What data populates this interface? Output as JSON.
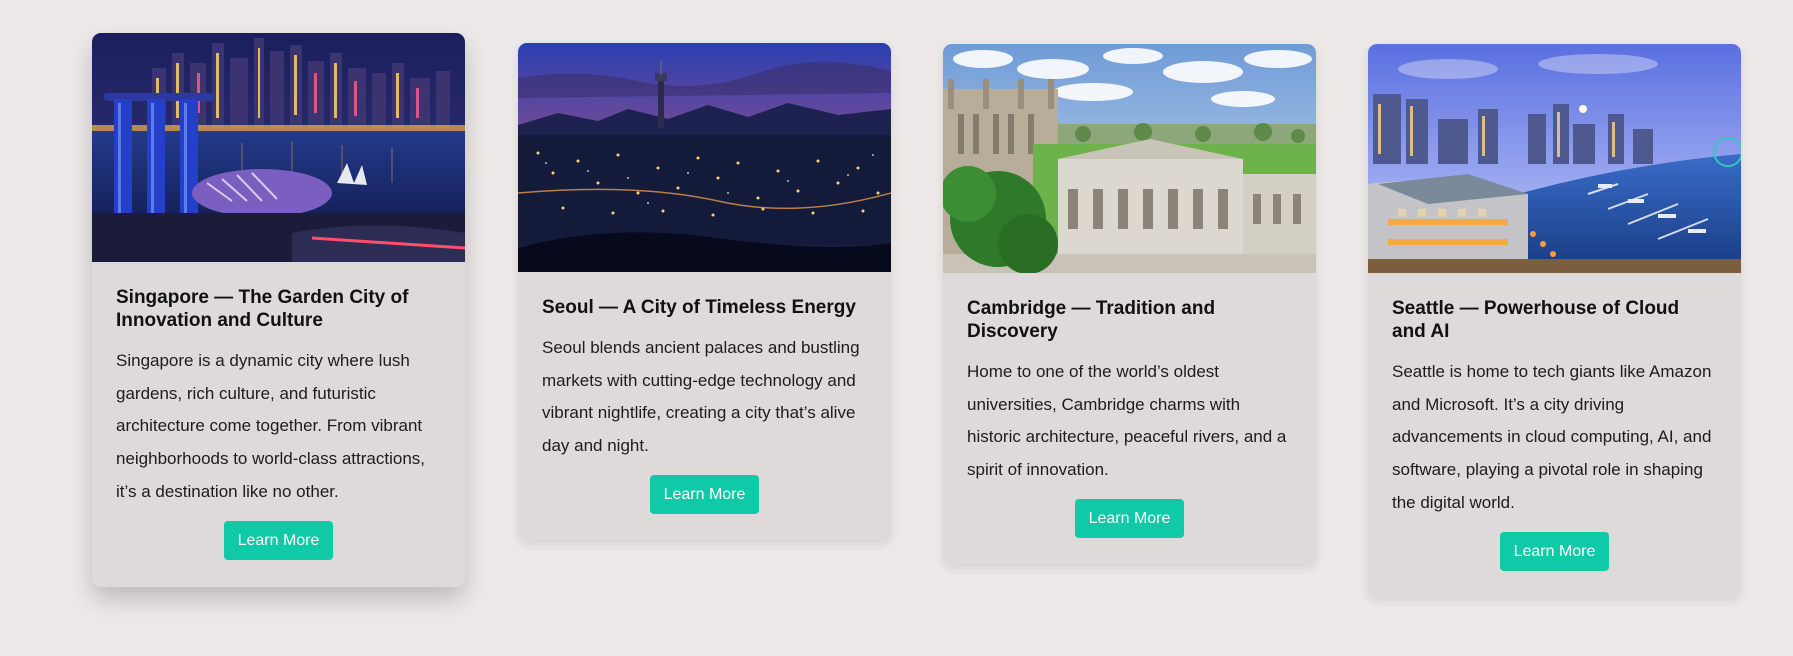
{
  "cards": [
    {
      "title": "Singapore — The Garden City of Innovation and Culture",
      "description": "Singapore is a dynamic city where lush gardens, rich culture, and futuristic architecture come together. From vibrant neighborhoods to world-class attractions, it’s a destination like no other.",
      "button_label": "Learn More",
      "image": "singapore-marina-bay-night-photo"
    },
    {
      "title": "Seoul — A City of Timeless Energy",
      "description": "Seoul blends ancient palaces and bustling markets with cutting-edge technology and vibrant nightlife, creating a city that’s alive day and night.",
      "button_label": "Learn More",
      "image": "seoul-skyline-night-photo"
    },
    {
      "title": "Cambridge — Tradition and Discovery",
      "description": "Home to one of the world’s oldest universities, Cambridge charms with historic architecture, peaceful rivers, and a spirit of innovation.",
      "button_label": "Learn More",
      "image": "cambridge-university-aerial-photo"
    },
    {
      "title": "Seattle — Powerhouse of Cloud and AI",
      "description": "Seattle is home to tech giants like Amazon and Microsoft. It’s a city driving advancements in cloud computing, AI, and software, playing a pivotal role in shaping the digital world.",
      "button_label": "Learn More",
      "image": "seattle-waterfront-marina-photo"
    }
  ],
  "colors": {
    "page_background": "#ede9e8",
    "card_background": "#dedad9",
    "button_background": "#10c9a6",
    "button_text": "#ffffff"
  }
}
